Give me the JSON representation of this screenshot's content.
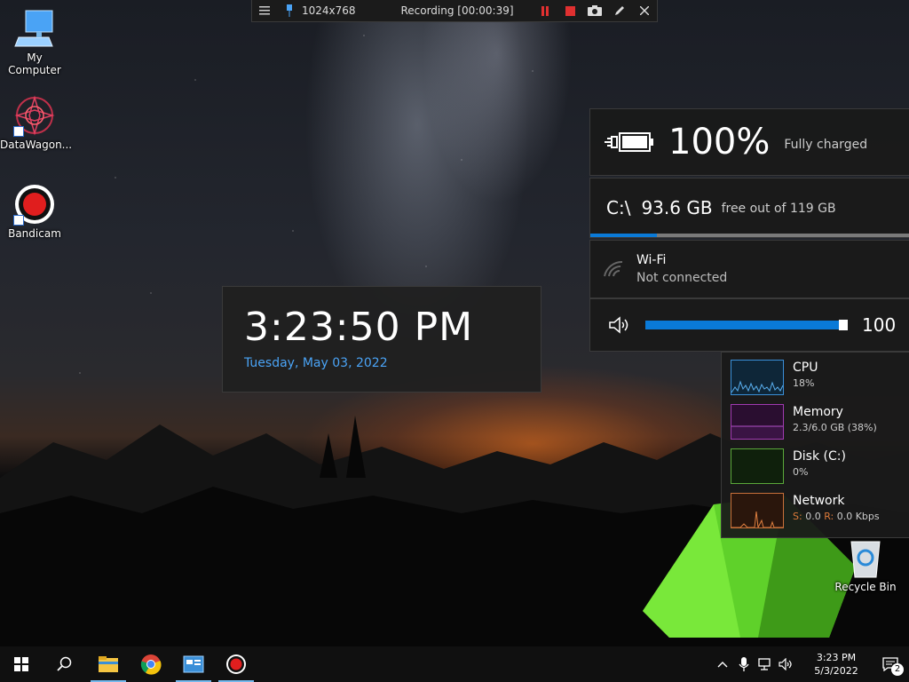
{
  "recording_bar": {
    "resolution": "1024x768",
    "recording_label": "Recording [00:00:39]"
  },
  "desktop_icons": [
    {
      "label": "My Computer"
    },
    {
      "label": "DataWagon..."
    },
    {
      "label": "Bandicam"
    },
    {
      "label": "Recycle Bin"
    }
  ],
  "clock_widget": {
    "time": "3:23:50 PM",
    "date": "Tuesday, May 03, 2022"
  },
  "battery": {
    "percent": "100%",
    "status": "Fully charged"
  },
  "disk": {
    "drive": "C:\\",
    "free": "93.6 GB",
    "total": "free out of 119 GB",
    "used_fraction": 0.21
  },
  "wifi": {
    "name": "Wi-Fi",
    "status": "Not connected"
  },
  "volume": {
    "value": "100",
    "level_fraction": 1.0
  },
  "performance": [
    {
      "name": "CPU",
      "value": "18%",
      "color": "#3a8fd8"
    },
    {
      "name": "Memory",
      "value": "2.3/6.0 GB (38%)",
      "color": "#a03ab0"
    },
    {
      "name": "Disk (C:)",
      "value": "0%",
      "color": "#5aa83a"
    },
    {
      "name": "Network",
      "send_label": "S:",
      "send_value": "0.0",
      "recv_label": "R:",
      "recv_value": "0.0 Kbps",
      "color": "#c8703a"
    }
  ],
  "taskbar": {
    "clock_time": "3:23 PM",
    "clock_date": "5/3/2022",
    "notification_count": "2"
  },
  "colors": {
    "accent": "#0a7ad8",
    "date_text": "#4aa3f5"
  }
}
